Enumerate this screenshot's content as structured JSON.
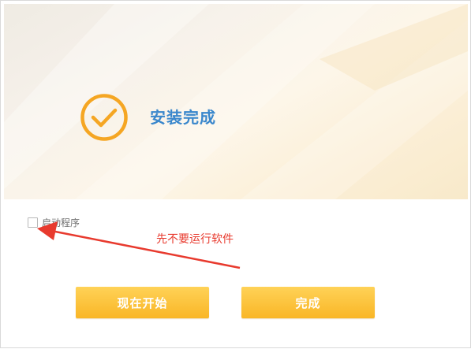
{
  "installer": {
    "status_title": "安装完成",
    "status_icon": "check-circle-icon",
    "launch_checkbox": {
      "label": "启动程序",
      "checked": false
    },
    "buttons": {
      "start_now": "现在开始",
      "finish": "完成"
    }
  },
  "annotation": {
    "text": "先不要运行软件",
    "color": "#e83a2e"
  },
  "colors": {
    "accent_orange": "#f5a623",
    "title_blue": "#3a87cc",
    "button_yellow": "#fbbf35"
  }
}
